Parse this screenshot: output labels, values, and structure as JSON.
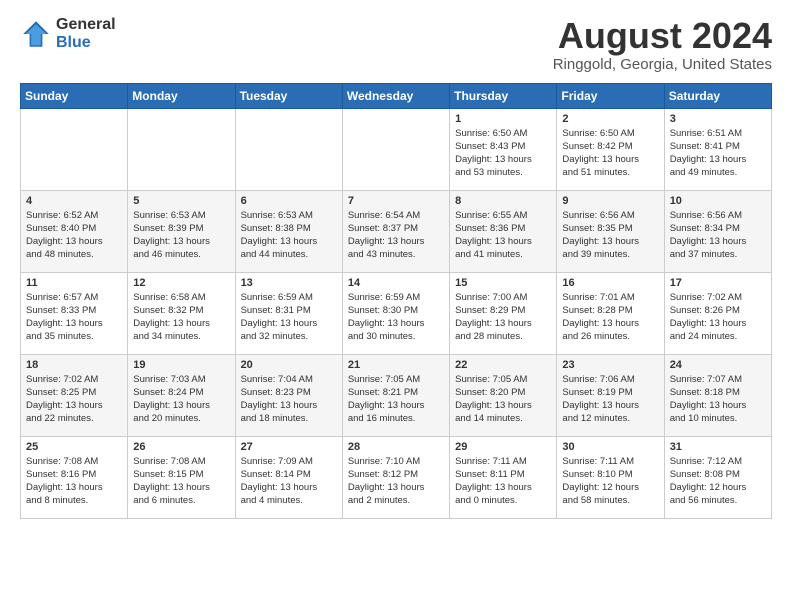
{
  "header": {
    "logo": {
      "general": "General",
      "blue": "Blue"
    },
    "title": "August 2024",
    "subtitle": "Ringgold, Georgia, United States"
  },
  "weekdays": [
    "Sunday",
    "Monday",
    "Tuesday",
    "Wednesday",
    "Thursday",
    "Friday",
    "Saturday"
  ],
  "weeks": [
    [
      {
        "day": "",
        "info": ""
      },
      {
        "day": "",
        "info": ""
      },
      {
        "day": "",
        "info": ""
      },
      {
        "day": "",
        "info": ""
      },
      {
        "day": "1",
        "info": "Sunrise: 6:50 AM\nSunset: 8:43 PM\nDaylight: 13 hours\nand 53 minutes."
      },
      {
        "day": "2",
        "info": "Sunrise: 6:50 AM\nSunset: 8:42 PM\nDaylight: 13 hours\nand 51 minutes."
      },
      {
        "day": "3",
        "info": "Sunrise: 6:51 AM\nSunset: 8:41 PM\nDaylight: 13 hours\nand 49 minutes."
      }
    ],
    [
      {
        "day": "4",
        "info": "Sunrise: 6:52 AM\nSunset: 8:40 PM\nDaylight: 13 hours\nand 48 minutes."
      },
      {
        "day": "5",
        "info": "Sunrise: 6:53 AM\nSunset: 8:39 PM\nDaylight: 13 hours\nand 46 minutes."
      },
      {
        "day": "6",
        "info": "Sunrise: 6:53 AM\nSunset: 8:38 PM\nDaylight: 13 hours\nand 44 minutes."
      },
      {
        "day": "7",
        "info": "Sunrise: 6:54 AM\nSunset: 8:37 PM\nDaylight: 13 hours\nand 43 minutes."
      },
      {
        "day": "8",
        "info": "Sunrise: 6:55 AM\nSunset: 8:36 PM\nDaylight: 13 hours\nand 41 minutes."
      },
      {
        "day": "9",
        "info": "Sunrise: 6:56 AM\nSunset: 8:35 PM\nDaylight: 13 hours\nand 39 minutes."
      },
      {
        "day": "10",
        "info": "Sunrise: 6:56 AM\nSunset: 8:34 PM\nDaylight: 13 hours\nand 37 minutes."
      }
    ],
    [
      {
        "day": "11",
        "info": "Sunrise: 6:57 AM\nSunset: 8:33 PM\nDaylight: 13 hours\nand 35 minutes."
      },
      {
        "day": "12",
        "info": "Sunrise: 6:58 AM\nSunset: 8:32 PM\nDaylight: 13 hours\nand 34 minutes."
      },
      {
        "day": "13",
        "info": "Sunrise: 6:59 AM\nSunset: 8:31 PM\nDaylight: 13 hours\nand 32 minutes."
      },
      {
        "day": "14",
        "info": "Sunrise: 6:59 AM\nSunset: 8:30 PM\nDaylight: 13 hours\nand 30 minutes."
      },
      {
        "day": "15",
        "info": "Sunrise: 7:00 AM\nSunset: 8:29 PM\nDaylight: 13 hours\nand 28 minutes."
      },
      {
        "day": "16",
        "info": "Sunrise: 7:01 AM\nSunset: 8:28 PM\nDaylight: 13 hours\nand 26 minutes."
      },
      {
        "day": "17",
        "info": "Sunrise: 7:02 AM\nSunset: 8:26 PM\nDaylight: 13 hours\nand 24 minutes."
      }
    ],
    [
      {
        "day": "18",
        "info": "Sunrise: 7:02 AM\nSunset: 8:25 PM\nDaylight: 13 hours\nand 22 minutes."
      },
      {
        "day": "19",
        "info": "Sunrise: 7:03 AM\nSunset: 8:24 PM\nDaylight: 13 hours\nand 20 minutes."
      },
      {
        "day": "20",
        "info": "Sunrise: 7:04 AM\nSunset: 8:23 PM\nDaylight: 13 hours\nand 18 minutes."
      },
      {
        "day": "21",
        "info": "Sunrise: 7:05 AM\nSunset: 8:21 PM\nDaylight: 13 hours\nand 16 minutes."
      },
      {
        "day": "22",
        "info": "Sunrise: 7:05 AM\nSunset: 8:20 PM\nDaylight: 13 hours\nand 14 minutes."
      },
      {
        "day": "23",
        "info": "Sunrise: 7:06 AM\nSunset: 8:19 PM\nDaylight: 13 hours\nand 12 minutes."
      },
      {
        "day": "24",
        "info": "Sunrise: 7:07 AM\nSunset: 8:18 PM\nDaylight: 13 hours\nand 10 minutes."
      }
    ],
    [
      {
        "day": "25",
        "info": "Sunrise: 7:08 AM\nSunset: 8:16 PM\nDaylight: 13 hours\nand 8 minutes."
      },
      {
        "day": "26",
        "info": "Sunrise: 7:08 AM\nSunset: 8:15 PM\nDaylight: 13 hours\nand 6 minutes."
      },
      {
        "day": "27",
        "info": "Sunrise: 7:09 AM\nSunset: 8:14 PM\nDaylight: 13 hours\nand 4 minutes."
      },
      {
        "day": "28",
        "info": "Sunrise: 7:10 AM\nSunset: 8:12 PM\nDaylight: 13 hours\nand 2 minutes."
      },
      {
        "day": "29",
        "info": "Sunrise: 7:11 AM\nSunset: 8:11 PM\nDaylight: 13 hours\nand 0 minutes."
      },
      {
        "day": "30",
        "info": "Sunrise: 7:11 AM\nSunset: 8:10 PM\nDaylight: 12 hours\nand 58 minutes."
      },
      {
        "day": "31",
        "info": "Sunrise: 7:12 AM\nSunset: 8:08 PM\nDaylight: 12 hours\nand 56 minutes."
      }
    ]
  ]
}
